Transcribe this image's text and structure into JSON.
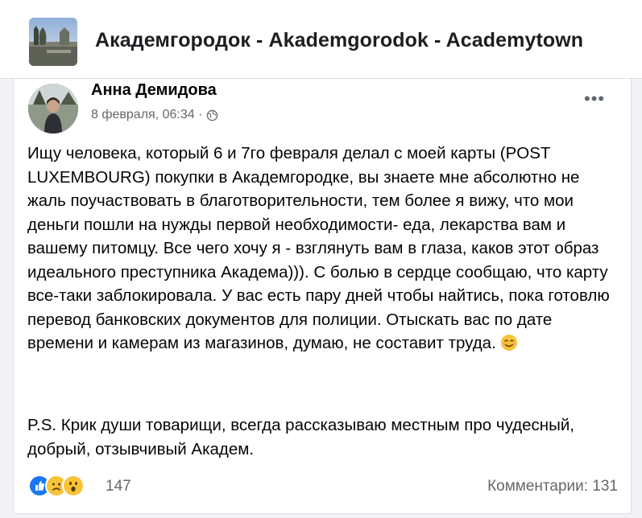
{
  "group": {
    "title": "Академгородок - Akademgorodok - Academytown"
  },
  "post": {
    "author": "Анна Демидова",
    "date": "8 февраля, 06:34 ·",
    "privacy_icon": "globe-icon",
    "more_icon": "more-options-icon",
    "body": "Ищу человека, который 6 и 7го февраля делал с моей карты (POST LUXEMBOURG) покупки в Академгородке, вы знаете мне абсолютно не жаль поучаствовать в благотворительности, тем более я вижу, что мои деньги пошли на нужды первой необходимости- еда, лекарства вам и вашему питомцу. Все чего хочу я - взглянуть вам в глаза, каков этот образ идеального преступника Академа))). С болью в сердце сообщаю, что карту все-таки заблокировала. У вас есть пару дней чтобы найтись, пока готовлю перевод банковских документов для полиции. Отыскать вас по дате времени и камерам из магазинов, думаю, не составит труда.",
    "body_emoji": "smiling-face-icon",
    "ps": "P.S. Крик души товарищи, всегда рассказываю местным про чудесный, добрый, отзывчивый Академ."
  },
  "footer": {
    "reactions": [
      "like-icon",
      "sad-icon",
      "wow-icon"
    ],
    "reactions_count": "147",
    "comments": "Комментарии: 131"
  },
  "colors": {
    "like": "#1877f2",
    "reaction_yellow": "#f7c439",
    "muted_text": "#65676b"
  }
}
